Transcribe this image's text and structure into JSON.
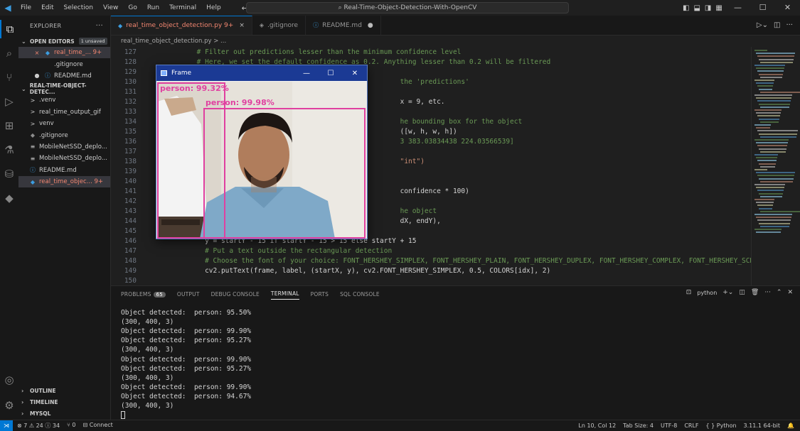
{
  "titlebar": {
    "menu": [
      "File",
      "Edit",
      "Selection",
      "View",
      "Go",
      "Run",
      "Terminal",
      "Help"
    ],
    "search": "Real-Time-Object-Detection-With-OpenCV",
    "nav": "← →"
  },
  "sidebar": {
    "title": "EXPLORER",
    "more": "···",
    "open_editors": {
      "label": "OPEN EDITORS",
      "badge": "1 unsaved"
    },
    "open_files": [
      {
        "name": "real_time_... 9+",
        "icon": "python-icon",
        "close": "×"
      },
      {
        "name": ".gitignore",
        "icon": ""
      },
      {
        "name": "README.md",
        "icon": "info-icon",
        "dot": "●"
      }
    ],
    "project": {
      "label": "REAL-TIME-OBJECT-DETEC..."
    },
    "tree": [
      {
        "name": ".venv",
        "chev": ">"
      },
      {
        "name": "real_time_output_gif",
        "chev": ">"
      },
      {
        "name": "venv",
        "chev": ">"
      },
      {
        "name": ".gitignore",
        "chev": ""
      },
      {
        "name": "MobileNetSSD_deplo...",
        "chev": ""
      },
      {
        "name": "MobileNetSSD_deplo...",
        "chev": ""
      },
      {
        "name": "README.md",
        "chev": ""
      },
      {
        "name": "real_time_objec... 9+",
        "chev": ""
      }
    ],
    "bottom": [
      "OUTLINE",
      "TIMELINE",
      "MYSQL"
    ]
  },
  "tabs": [
    {
      "label": "real_time_object_detection.py 9+",
      "close": "×"
    },
    {
      "label": ".gitignore"
    },
    {
      "label": "README.md",
      "dot": "●"
    }
  ],
  "breadcrumb": "real_time_object_detection.py > ...",
  "editor": {
    "line_numbers": [
      "127",
      "128",
      "129",
      "130",
      "131",
      "132",
      "133",
      "134",
      "135",
      "136",
      "137",
      "138",
      "139",
      "140",
      "141",
      "142",
      "143",
      "144",
      "145",
      "146",
      "147",
      "148",
      "149",
      "150"
    ],
    "lines": [
      {
        "text": "            # Filter out predictions lesser than the minimum confidence level",
        "cls": "cm"
      },
      {
        "text": "            # Here, we set the default confidence as 0.2. Anything lesser than 0.2 will be filtered",
        "cls": "cm"
      },
      {
        "text": "",
        "cls": ""
      },
      {
        "text": "                                                              the 'predictions'",
        "cls": "cm"
      },
      {
        "text": "",
        "cls": ""
      },
      {
        "text": "                                                              x = 9, etc.",
        "cls": ""
      },
      {
        "text": "",
        "cls": ""
      },
      {
        "text": "                                                              he bounding box for the object",
        "cls": "cm"
      },
      {
        "text": "                                                              ([w, h, w, h])",
        "cls": ""
      },
      {
        "text": "                                                              3 383.03834438 224.03566539]",
        "cls": "cm"
      },
      {
        "text": "",
        "cls": ""
      },
      {
        "text": "                                                              \"int\")",
        "cls": "st"
      },
      {
        "text": "",
        "cls": ""
      },
      {
        "text": "",
        "cls": ""
      },
      {
        "text": "                                                              confidence * 100)",
        "cls": ""
      },
      {
        "text": "",
        "cls": ""
      },
      {
        "text": "                                                              he object",
        "cls": "cm"
      },
      {
        "text": "                                                              dX, endY),",
        "cls": ""
      },
      {
        "text": "",
        "cls": ""
      },
      {
        "text": "              y = startY - 15 if startY - 15 > 15 else startY + 15",
        "cls": ""
      },
      {
        "text": "              # Put a text outside the rectangular detection",
        "cls": "cm"
      },
      {
        "text": "              # Choose the font of your choice: FONT_HERSHEY_SIMPLEX, FONT_HERSHEY_PLAIN, FONT_HERSHEY_DUPLEX, FONT_HERSHEY_COMPLEX, FONT_HERSHEY_SCRI",
        "cls": "cm"
      },
      {
        "text": "              cv2.putText(frame, label, (startX, y), cv2.FONT_HERSHEY_SIMPLEX, 0.5, COLORS[idx], 2)",
        "cls": ""
      },
      {
        "text": "",
        "cls": ""
      }
    ]
  },
  "frame_window": {
    "title": "Frame",
    "controls": [
      "—",
      "☐",
      "✕"
    ],
    "labels": [
      "person: 99.32%",
      "person: 99.98%"
    ]
  },
  "panel": {
    "tabs": [
      "PROBLEMS",
      "OUTPUT",
      "DEBUG CONSOLE",
      "TERMINAL",
      "PORTS",
      "SQL CONSOLE"
    ],
    "problems_count": "65",
    "active_tab": "TERMINAL",
    "shell": "python",
    "terminal": [
      "Object detected:  person: 95.50%",
      "(300, 400, 3)",
      "Object detected:  person: 99.90%",
      "Object detected:  person: 95.27%",
      "(300, 400, 3)",
      "Object detected:  person: 99.90%",
      "Object detected:  person: 95.27%",
      "(300, 400, 3)",
      "Object detected:  person: 99.90%",
      "Object detected:  person: 94.67%",
      "(300, 400, 3)"
    ]
  },
  "status": {
    "errors": "⊗ 7 ⚠ 24 ⓘ 34",
    "ports": "⑂ 0",
    "connect": "Connect",
    "position": "Ln 10, Col 12",
    "tab_size": "Tab Size: 4",
    "encoding": "UTF-8",
    "eol": "CRLF",
    "language": "{ } Python",
    "interpreter": "3.11.1 64-bit"
  },
  "colors": {
    "accent": "#0078d4",
    "bbox": "#e040a0",
    "frame_title": "#1b3a94"
  }
}
